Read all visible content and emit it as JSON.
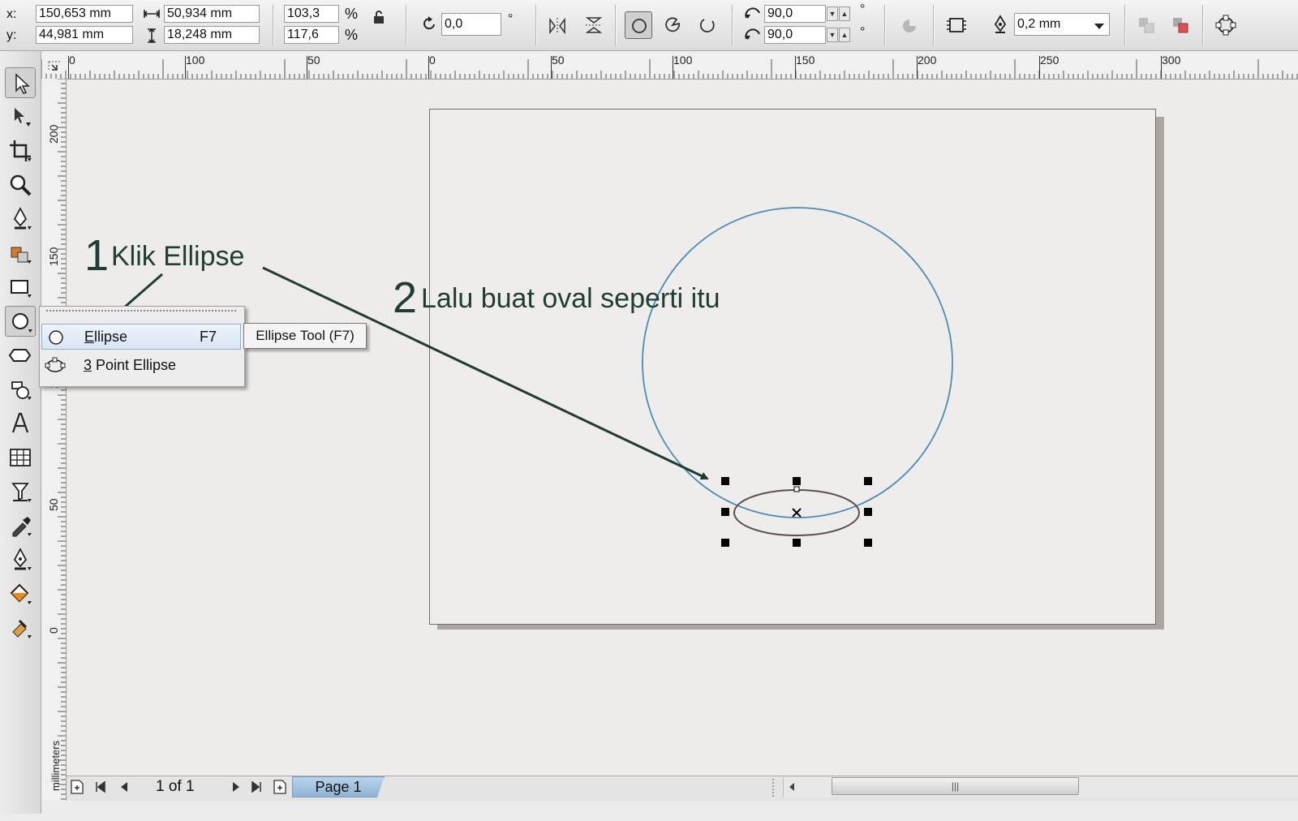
{
  "property_bar": {
    "x_label": "x:",
    "x_value": "150,653 mm",
    "y_label": "y:",
    "y_value": "44,981 mm",
    "width_value": "50,934 mm",
    "height_value": "18,248 mm",
    "scale_x": "103,3",
    "scale_y": "117,6",
    "percent": "%",
    "rotation": "0,0",
    "degree": "°",
    "start_angle": "90,0",
    "end_angle": "90,0",
    "outline_width": "0,2 mm"
  },
  "rulers": {
    "h_ticks": [
      "0",
      "100",
      "50",
      "0",
      "50",
      "100",
      "150",
      "200",
      "250",
      "300"
    ],
    "v_ticks": [
      "200",
      "150",
      "100",
      "50",
      "0"
    ],
    "unit_label": "millimeters"
  },
  "flyout": {
    "items": [
      {
        "label_hotkey": "E",
        "label_rest": "llipse",
        "shortcut": "F7"
      },
      {
        "label_hotkey": "3",
        "label_rest": " Point Ellipse",
        "shortcut": ""
      }
    ],
    "tooltip": "Ellipse Tool (F7)"
  },
  "annotations": {
    "step1_num": "1",
    "step1_text": "Klik Ellipse",
    "step2_num": "2",
    "step2_text": "Lalu buat oval seperti itu"
  },
  "status": {
    "page_counter": "1 of 1",
    "page_tab": "Page 1"
  },
  "colors": {
    "circle_stroke": "#4a8db5",
    "ellipse_stroke": "#5a4e48",
    "annotation": "#1f3d35",
    "page_tab": "#a6c6e4"
  }
}
